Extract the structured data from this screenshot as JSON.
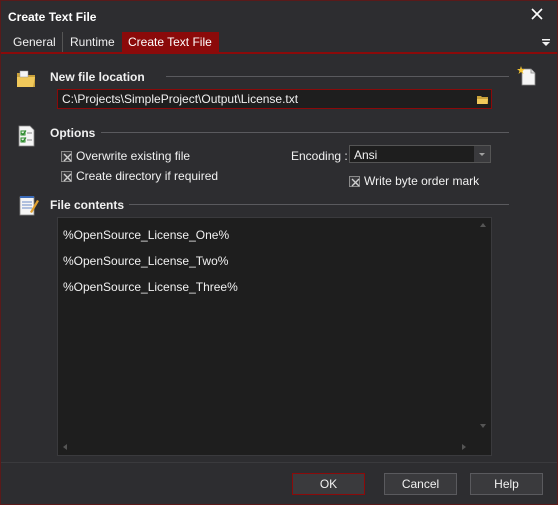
{
  "window": {
    "title": "Create Text File"
  },
  "tabs": [
    {
      "label": "General"
    },
    {
      "label": "Runtime"
    },
    {
      "label": "Create Text File"
    }
  ],
  "sections": {
    "location": {
      "title": "New file location"
    },
    "options": {
      "title": "Options"
    },
    "contents": {
      "title": "File contents"
    }
  },
  "path": {
    "value": "C:\\Projects\\SimpleProject\\Output\\License.txt"
  },
  "options": {
    "overwrite": {
      "label": "Overwrite existing file",
      "checked": true
    },
    "create_dir": {
      "label": "Create directory if required",
      "checked": true
    },
    "encoding_label": "Encoding :",
    "encoding_value": "Ansi",
    "bom": {
      "label": "Write byte order mark",
      "checked": true
    }
  },
  "file_contents": [
    "%OpenSource_License_One%",
    "%OpenSource_License_Two%",
    "%OpenSource_License_Three%"
  ],
  "buttons": {
    "ok": "OK",
    "cancel": "Cancel",
    "help": "Help"
  },
  "colors": {
    "accent": "#8b0a0a",
    "background": "#2d2d30",
    "field": "#1e1e1e"
  }
}
